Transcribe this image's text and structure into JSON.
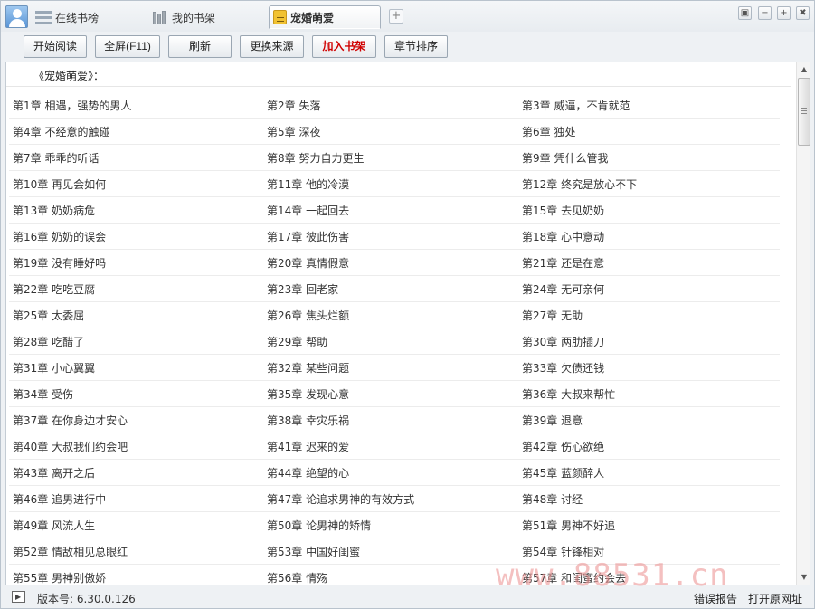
{
  "tabs": [
    {
      "label": "在线书榜"
    },
    {
      "label": "我的书架"
    },
    {
      "label": "宠婚萌爱"
    }
  ],
  "toolbar": {
    "start_reading": "开始阅读",
    "fullscreen": "全屏(F11)",
    "refresh": "刷新",
    "change_source": "更换来源",
    "add_to_shelf": "加入书架",
    "sort_chapters": "章节排序"
  },
  "book": {
    "title": "《宠婚萌爱》："
  },
  "chapters": [
    "第1章 相遇，强势的男人",
    "第2章 失落",
    "第3章 威逼，不肯就范",
    "第4章 不经意的触碰",
    "第5章 深夜",
    "第6章 独处",
    "第7章 乖乖的听话",
    "第8章 努力自力更生",
    "第9章 凭什么管我",
    "第10章 再见会如何",
    "第11章 他的冷漠",
    "第12章 终究是放心不下",
    "第13章 奶奶病危",
    "第14章 一起回去",
    "第15章 去见奶奶",
    "第16章 奶奶的误会",
    "第17章 彼此伤害",
    "第18章 心中意动",
    "第19章 没有睡好吗",
    "第20章 真情假意",
    "第21章 还是在意",
    "第22章 吃吃豆腐",
    "第23章 回老家",
    "第24章 无可亲何",
    "第25章 太委屈",
    "第26章 焦头烂额",
    "第27章 无助",
    "第28章 吃醋了",
    "第29章 帮助",
    "第30章 两肋插刀",
    "第31章 小心翼翼",
    "第32章 某些问题",
    "第33章 欠债还钱",
    "第34章 受伤",
    "第35章 发现心意",
    "第36章 大叔来帮忙",
    "第37章 在你身边才安心",
    "第38章 幸灾乐祸",
    "第39章 退意",
    "第40章 大叔我们约会吧",
    "第41章 迟来的爱",
    "第42章 伤心欲绝",
    "第43章 离开之后",
    "第44章 绝望的心",
    "第45章 蓝颜醉人",
    "第46章 追男进行中",
    "第47章 论追求男神的有效方式",
    "第48章 讨经",
    "第49章 风流人生",
    "第50章 论男神的矫情",
    "第51章 男神不好追",
    "第52章 情敌相见总眼红",
    "第53章 中国好闺蜜",
    "第54章 针锋相对",
    "第55章 男神别傲娇",
    "第56章 情殇",
    "第57章 和闺蜜约会去"
  ],
  "status": {
    "version": "版本号: 6.30.0.126",
    "error_report": "错误报告",
    "open_source": "打开原网址"
  },
  "watermark": "www.88531.cn"
}
